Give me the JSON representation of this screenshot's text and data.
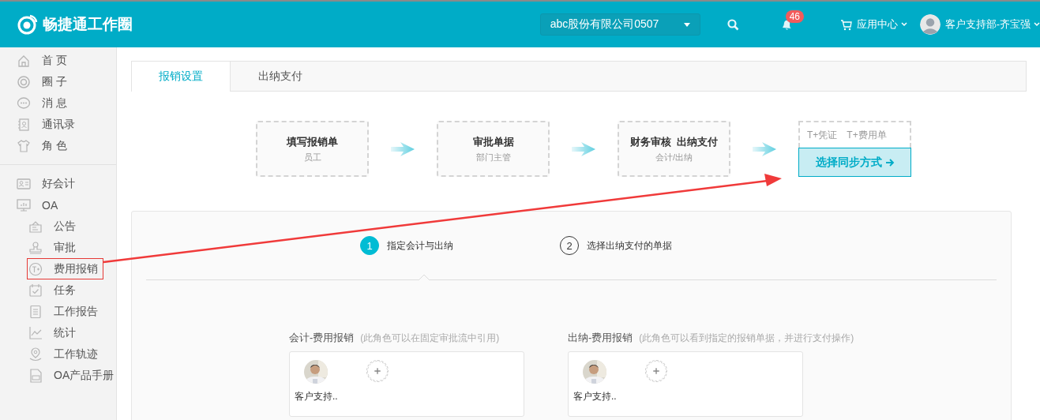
{
  "header": {
    "logo_text": "畅捷通工作圈",
    "company_select": {
      "value": "abc股份有限公司0507"
    },
    "notification_count": "46",
    "app_center": "应用中心",
    "user_name": "客户支持部-齐宝强"
  },
  "sidebar": {
    "groups": [
      {
        "items": [
          {
            "label": "首 页",
            "highlighted": false
          },
          {
            "label": "圈 子",
            "highlighted": false
          },
          {
            "label": "消 息",
            "highlighted": false
          },
          {
            "label": "通讯录",
            "highlighted": false
          },
          {
            "label": "角 色",
            "highlighted": false
          }
        ]
      },
      {
        "items": [
          {
            "label": "好会计",
            "highlighted": false
          },
          {
            "label": "OA",
            "highlighted": false,
            "children": [
              {
                "label": "公告",
                "highlighted": false
              },
              {
                "label": "审批",
                "highlighted": false
              },
              {
                "label": "费用报销",
                "highlighted": true
              },
              {
                "label": "任务",
                "highlighted": false
              },
              {
                "label": "工作报告",
                "highlighted": false
              },
              {
                "label": "统计",
                "highlighted": false
              },
              {
                "label": "工作轨迹",
                "highlighted": false
              },
              {
                "label": "OA产品手册",
                "highlighted": false
              }
            ]
          }
        ]
      }
    ]
  },
  "tabs": [
    {
      "label": "报销设置",
      "selected": true
    },
    {
      "label": "出纳支付",
      "selected": false
    }
  ],
  "flow": {
    "steps": [
      {
        "title": "填写报销单",
        "subtitle": "员工"
      },
      {
        "title": "审批单据",
        "subtitle": "部门主管"
      },
      {
        "title": "财务审核  出纳支付",
        "subtitle": "会计/出纳"
      }
    ],
    "sync": {
      "options": [
        "T+凭证",
        "T+费用单"
      ],
      "button": "选择同步方式"
    }
  },
  "wizard": {
    "steps": [
      {
        "number": "1",
        "label": "指定会计与出纳",
        "selected": true
      },
      {
        "number": "2",
        "label": "选择出纳支付的单据",
        "selected": false
      }
    ]
  },
  "roles": [
    {
      "title": "会计-费用报销",
      "hint": "(此角色可以在固定审批流中引用)",
      "members": [
        {
          "name": "客户支持.."
        }
      ]
    },
    {
      "title": "出纳-费用报销",
      "hint": "(此角色可以看到指定的报销单据，并进行支付操作)",
      "members": [
        {
          "name": "客户支持.."
        }
      ]
    }
  ],
  "annotation": {
    "arrow": true
  }
}
